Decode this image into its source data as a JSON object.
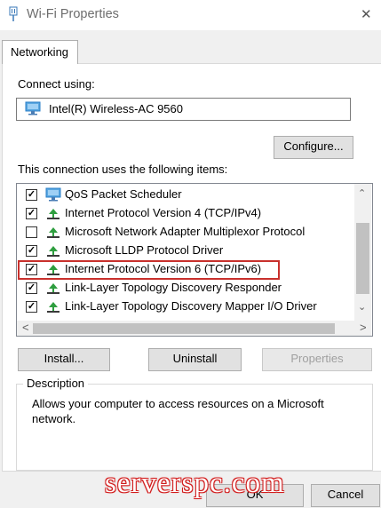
{
  "window": {
    "title": "Wi-Fi Properties",
    "close_glyph": "✕",
    "icon": "network-adapter-icon"
  },
  "tabs": [
    {
      "label": "Networking",
      "active": true
    }
  ],
  "connect_using": {
    "label": "Connect using:",
    "adapter": "Intel(R) Wireless-AC 9560",
    "configure_label": "Configure..."
  },
  "items_section": {
    "label": "This connection uses the following items:",
    "items": [
      {
        "label": "QoS Packet Scheduler",
        "checked": true,
        "icon": "qos-scheduler-icon"
      },
      {
        "label": "Internet Protocol Version 4 (TCP/IPv4)",
        "checked": true,
        "icon": "protocol-icon"
      },
      {
        "label": "Microsoft Network Adapter Multiplexor Protocol",
        "checked": false,
        "icon": "protocol-icon"
      },
      {
        "label": "Microsoft LLDP Protocol Driver",
        "checked": true,
        "icon": "protocol-icon"
      },
      {
        "label": "Internet Protocol Version 6 (TCP/IPv6)",
        "checked": true,
        "icon": "protocol-icon",
        "highlighted": true
      },
      {
        "label": "Link-Layer Topology Discovery Responder",
        "checked": true,
        "icon": "protocol-icon"
      },
      {
        "label": "Link-Layer Topology Discovery Mapper I/O Driver",
        "checked": true,
        "icon": "protocol-icon"
      }
    ],
    "scroll_up": "⌃",
    "scroll_down": "⌄",
    "scroll_left": "<",
    "scroll_right": ">"
  },
  "buttons": {
    "install": "Install...",
    "uninstall": "Uninstall",
    "properties": "Properties",
    "ok": "OK",
    "cancel": "Cancel"
  },
  "description": {
    "title": "Description",
    "text": "Allows your computer to access resources on a Microsoft network."
  },
  "watermark": "serverspc.com",
  "colors": {
    "highlight_border": "#c8302c",
    "protocol_green": "#2e9e3f",
    "adapter_blue": "#2a7fc9"
  }
}
